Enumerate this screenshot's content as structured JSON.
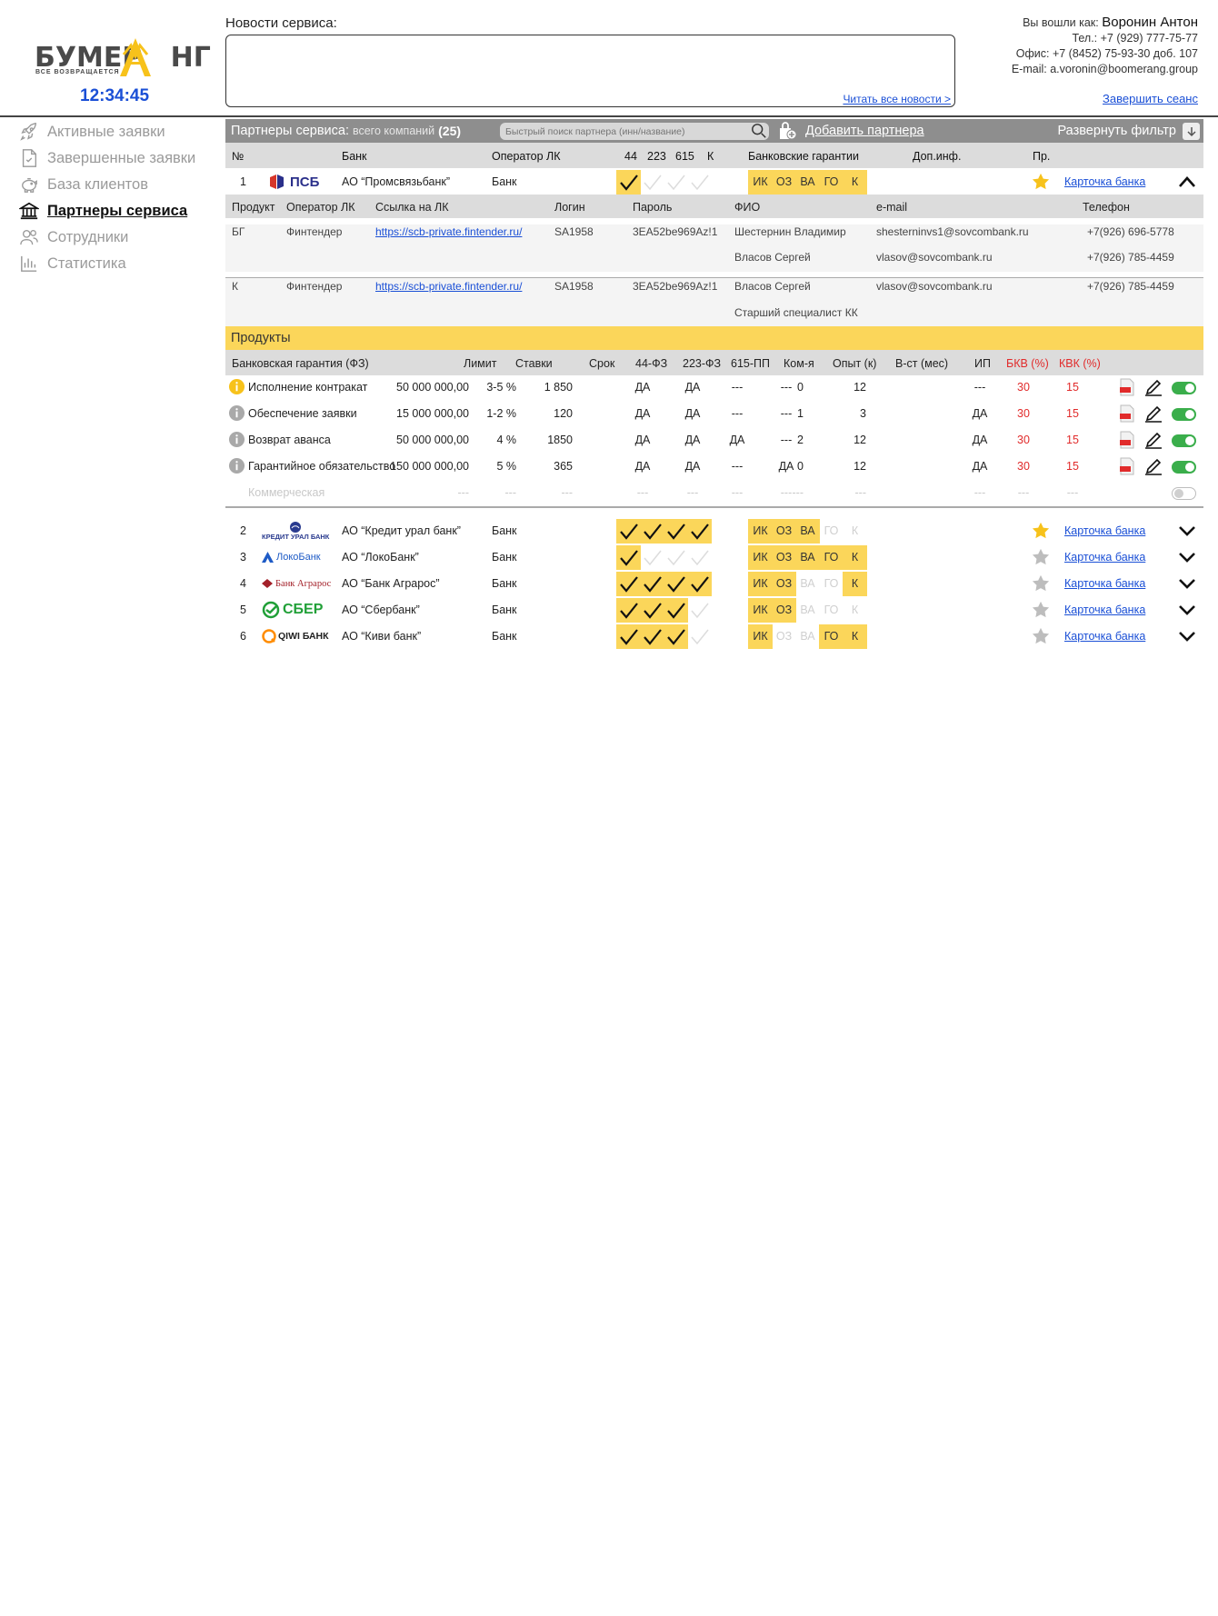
{
  "header": {
    "logo_text": "БУМЕРАНГ",
    "logo_tagline": "ВСЕ ВОЗВРАЩАЕТСЯ",
    "clock": "12:34:45",
    "news_label": "Новости сервиса:",
    "news_link": "Читать все новости >",
    "user": {
      "logged_as_label": "Вы вошли как:",
      "name": "Воронин Антон",
      "phone": "Тел.: +7 (929) 777-75-77",
      "office": "Офис: +7 (8452) 75-93-30 доб. 107",
      "email": "E-mail: a.voronin@boomerang.group",
      "logout": "Завершить сеанс"
    }
  },
  "sidebar": {
    "items": [
      {
        "label": "Активные заявки",
        "icon": "rocket-icon",
        "active": false
      },
      {
        "label": "Завершенные заявки",
        "icon": "document-check-icon",
        "active": false
      },
      {
        "label": "База клиентов",
        "icon": "piggy-bank-icon",
        "active": false
      },
      {
        "label": "Партнеры сервиса",
        "icon": "bank-building-icon",
        "active": true
      },
      {
        "label": "Сотрудники",
        "icon": "users-icon",
        "active": false
      },
      {
        "label": "Статистика",
        "icon": "bar-chart-icon",
        "active": false
      }
    ]
  },
  "partners": {
    "title": "Партнеры сервиса:",
    "count_label": "всего компаний",
    "count": "(25)",
    "search_placeholder": "Быстрый поиск партнера (инн/название)",
    "add_button": "Добавить партнера",
    "expand_filter": "Развернуть фильтр",
    "columns": {
      "num": "№",
      "bank": "Банк",
      "operator": "Оператор ЛК",
      "c44": "44",
      "c223": "223",
      "c615": "615",
      "ck": "К",
      "guarantees": "Банковские гарантии",
      "extra": "Доп.инф.",
      "pr": "Пр."
    },
    "guarantee_tags": [
      "ИК",
      "ОЗ",
      "ВА",
      "ГО",
      "К"
    ],
    "card_link": "Карточка банка",
    "rows": [
      {
        "num": "1",
        "logo": "ПСБ",
        "name": "АО “Промсвязьбанк”",
        "operator": "Банк",
        "checks": [
          true,
          false,
          false,
          false
        ],
        "tags": [
          true,
          true,
          true,
          true,
          true
        ],
        "starred": true,
        "expanded": true
      },
      {
        "num": "2",
        "logo": "КРЕДИТ УРАЛ БАНК",
        "name": "АО “Кредит урал банк”",
        "operator": "Банк",
        "checks": [
          true,
          true,
          true,
          true
        ],
        "tags": [
          true,
          true,
          true,
          false,
          false
        ],
        "starred": true,
        "expanded": false
      },
      {
        "num": "3",
        "logo": "ЛокоБанк",
        "name": "АО “ЛокоБанк”",
        "operator": "Банк",
        "checks": [
          true,
          false,
          false,
          false
        ],
        "tags": [
          true,
          true,
          true,
          true,
          true
        ],
        "starred": false,
        "expanded": false
      },
      {
        "num": "4",
        "logo": "Банк Аграрос",
        "name": "АО “Банк Аграрос”",
        "operator": "Банк",
        "checks": [
          true,
          true,
          true,
          true
        ],
        "tags": [
          true,
          true,
          false,
          false,
          true
        ],
        "starred": false,
        "expanded": false
      },
      {
        "num": "5",
        "logo": "СБЕР",
        "name": "АО “Сбербанк”",
        "operator": "Банк",
        "checks": [
          true,
          true,
          true,
          false
        ],
        "tags": [
          true,
          true,
          false,
          false,
          false
        ],
        "starred": false,
        "expanded": false
      },
      {
        "num": "6",
        "logo": "QIWI БАНК",
        "name": "АО “Киви банк”",
        "operator": "Банк",
        "checks": [
          true,
          true,
          true,
          false
        ],
        "tags": [
          true,
          false,
          false,
          true,
          true
        ],
        "starred": false,
        "expanded": false
      }
    ],
    "accounts": {
      "columns": {
        "product": "Продукт",
        "operator": "Оператор ЛК",
        "link": "Ссылка на ЛК",
        "login": "Логин",
        "password": "Пароль",
        "fio": "ФИО",
        "email": "e-mail",
        "phone": "Телефон"
      },
      "rows": [
        {
          "product": "БГ",
          "operator": "Финтендер",
          "link": "https://scb-private.fintender.ru/",
          "login": "SA1958",
          "password": "3EA52be969Az!1",
          "fio1": "Шестернин Владимир",
          "email1": "shesterninvs1@sovcombank.ru",
          "phone1": "+7(926) 696-5778",
          "fio2": "Власов Сергей",
          "email2": "vlasov@sovcombank.ru",
          "phone2": "+7(926) 785-4459"
        },
        {
          "product": "К",
          "operator": "Финтендер",
          "link": "https://scb-private.fintender.ru/",
          "login": "SA1958",
          "password": "3EA52be969Az!1",
          "fio1": "Власов Сергей",
          "email1": "vlasov@sovcombank.ru",
          "phone1": "+7(926) 785-4459",
          "fio2": "Старший специалист КК"
        }
      ]
    },
    "products": {
      "title": "Продукты",
      "columns": {
        "name": "Банковская гарантия (ФЗ)",
        "limit": "Лимит",
        "rates": "Ставки",
        "term": "Срок",
        "fz44": "44-ФЗ",
        "fz223": "223-ФЗ",
        "pp615": "615-ПП",
        "kom": "Ком-я",
        "exp": "Опыт (к)",
        "vst": "В-ст (мес)",
        "ip": "ИП",
        "bkv": "БКВ (%)",
        "kvk": "КВК (%)"
      },
      "rows": [
        {
          "name": "Исполнение контракат",
          "limit": "50 000 000,00",
          "rates": "3-5 %",
          "term": "1 850",
          "fz44": "ДА",
          "fz223": "ДА",
          "pp615": "---",
          "kom": "---",
          "exp": "0",
          "vst": "12",
          "ip": "---",
          "bkv": "30",
          "kvk": "15",
          "highlight": true,
          "enabled": true
        },
        {
          "name": "Обеспечение заявки",
          "limit": "15 000 000,00",
          "rates": "1-2 %",
          "term": "120",
          "fz44": "ДА",
          "fz223": "ДА",
          "pp615": "---",
          "kom": "---",
          "exp": "1",
          "vst": "3",
          "ip": "ДА",
          "bkv": "30",
          "kvk": "15",
          "highlight": false,
          "enabled": true
        },
        {
          "name": "Возврат аванса",
          "limit": "50 000 000,00",
          "rates": "4 %",
          "term": "1850",
          "fz44": "ДА",
          "fz223": "ДА",
          "pp615": "ДА",
          "kom": "---",
          "exp": "2",
          "vst": "12",
          "ip": "ДА",
          "bkv": "30",
          "kvk": "15",
          "highlight": false,
          "enabled": true
        },
        {
          "name": "Гарантийное обязательство",
          "limit": "150 000 000,00",
          "rates": "5 %",
          "term": "365",
          "fz44": "ДА",
          "fz223": "ДА",
          "pp615": "---",
          "kom": "ДА",
          "exp": "0",
          "vst": "12",
          "ip": "ДА",
          "bkv": "30",
          "kvk": "15",
          "highlight": false,
          "enabled": true
        },
        {
          "name": "Коммерческая",
          "limit": "---",
          "rates": "---",
          "term": "---",
          "fz44": "---",
          "fz223": "---",
          "pp615": "---",
          "kom": "---",
          "exp": "---",
          "vst": "---",
          "ip": "---",
          "bkv": "---",
          "kvk": "---",
          "highlight": false,
          "enabled": false,
          "disabled": true
        }
      ]
    }
  },
  "colors": {
    "accent_yellow": "#fbd65a",
    "link_blue": "#1a4fd6",
    "header_gray": "#8e8e8e",
    "red": "#e12b2b",
    "toggle_green": "#3aae4b"
  }
}
